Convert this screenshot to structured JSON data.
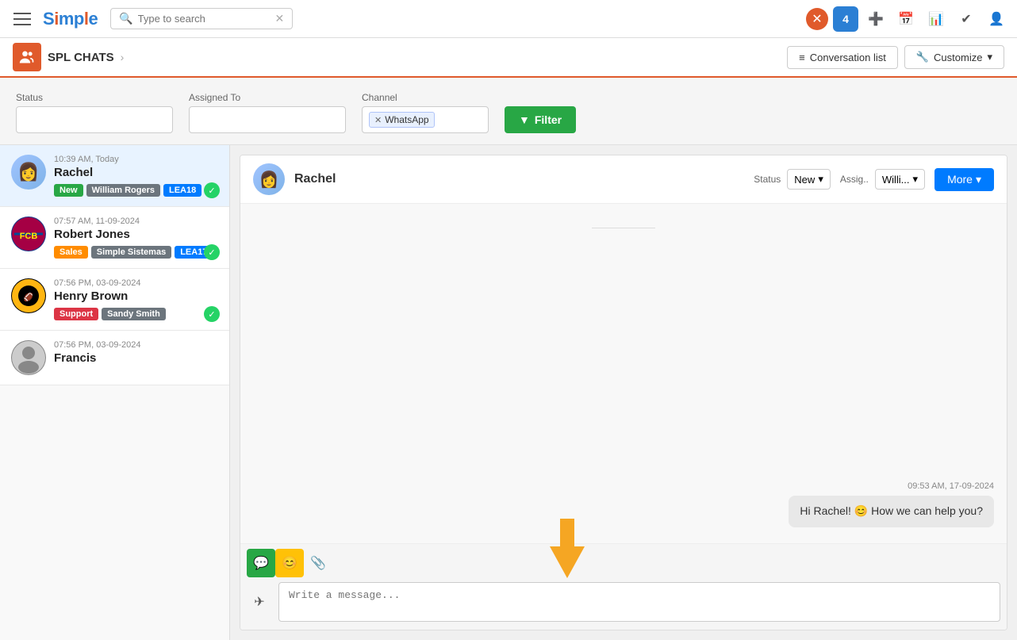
{
  "app": {
    "logo": "Simple",
    "logo_accent": "le"
  },
  "navbar": {
    "search_placeholder": "Type to search",
    "icons": [
      "☰",
      "✕",
      "4",
      "+",
      "📅",
      "📊",
      "✔",
      "👤"
    ]
  },
  "breadcrumb": {
    "icon": "👥",
    "title": "SPL CHATS",
    "arrow": "›",
    "conversation_list_label": "Conversation list",
    "customize_label": "Customize"
  },
  "filter": {
    "status_label": "Status",
    "status_value": "",
    "assigned_to_label": "Assigned To",
    "assigned_to_value": "",
    "channel_label": "Channel",
    "channel_tag": "WhatsApp",
    "filter_btn": "Filter"
  },
  "contacts": [
    {
      "name": "Rachel",
      "time": "10:39 AM, Today",
      "tags": [
        "New",
        "William Rogers",
        "LEA18"
      ],
      "tag_classes": [
        "tag-new",
        "tag-william",
        "tag-lea18"
      ],
      "avatar_emoji": "👩",
      "has_whatsapp": true,
      "active": true
    },
    {
      "name": "Robert Jones",
      "time": "07:57 AM, 11-09-2024",
      "tags": [
        "Sales",
        "Simple Sistemas",
        "LEA17"
      ],
      "tag_classes": [
        "tag-sales",
        "tag-simple",
        "tag-lea18"
      ],
      "avatar_emoji": "⚽",
      "has_whatsapp": true,
      "active": false
    },
    {
      "name": "Henry Brown",
      "time": "07:56 PM, 03-09-2024",
      "tags": [
        "Support",
        "Sandy Smith"
      ],
      "tag_classes": [
        "tag-support",
        "tag-sandy"
      ],
      "avatar_emoji": "🏈",
      "has_whatsapp": true,
      "active": false
    },
    {
      "name": "Francis",
      "time": "07:56 PM, 03-09-2024",
      "tags": [],
      "tag_classes": [],
      "avatar_emoji": "👤",
      "has_whatsapp": false,
      "active": false
    }
  ],
  "chat": {
    "contact_name": "Rachel",
    "avatar_emoji": "👩",
    "status_label": "Status",
    "status_value": "New",
    "assign_label": "Assig..",
    "assign_value": "Willi...",
    "more_btn": "More",
    "message_timestamp": "09:53 AM, 17-09-2024",
    "message_text": "Hi Rachel! 😊 How we can help you?",
    "input_placeholder": "Write a message...",
    "divider": ""
  }
}
